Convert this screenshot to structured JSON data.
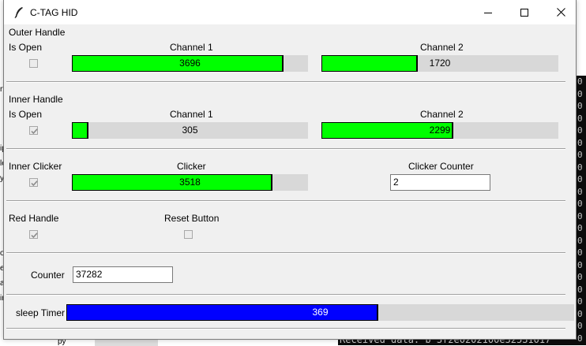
{
  "window": {
    "title": "C-TAG HID"
  },
  "sections": {
    "outer_handle": {
      "title": "Outer Handle",
      "is_open_label": "Is Open",
      "is_open_checked": false,
      "channel1": {
        "label": "Channel 1",
        "value": "3696",
        "fill": 0.895
      },
      "channel2": {
        "label": "Channel 2",
        "value": "1720",
        "fill": 0.405
      }
    },
    "inner_handle": {
      "title": "Inner Handle",
      "is_open_label": "Is Open",
      "is_open_checked": true,
      "channel1": {
        "label": "Channel 1",
        "value": "305",
        "fill": 0.07
      },
      "channel2": {
        "label": "Channel 2",
        "value": "2299",
        "fill": 0.555
      }
    },
    "inner_clicker": {
      "title": "Inner Clicker",
      "checked": true,
      "clicker": {
        "label": "Clicker",
        "value": "3518",
        "fill": 0.85
      },
      "counter_label": "Clicker Counter",
      "counter_value": "2"
    },
    "red_handle": {
      "title": "Red Handle",
      "checked": true,
      "reset_label": "Reset Button",
      "reset_checked": false
    },
    "counter": {
      "label": "Counter",
      "value": "37282"
    },
    "sleep_timer": {
      "label": "sleep Timer",
      "value": "369",
      "fill": 0.615
    }
  },
  "background": {
    "terminal_bottom_text": "Received data: b'3f2e0202100e32531017",
    "terminal_right_chars": [
      "0",
      "0",
      "0",
      "0",
      "0",
      "0",
      "0",
      "0",
      "0",
      "0",
      "0",
      "0",
      "0",
      "0",
      "0",
      "0",
      "0",
      "0",
      "0",
      "0",
      "0",
      "0"
    ],
    "left_fragments": [
      "rt",
      "ip",
      "le",
      "y",
      "ot",
      "er",
      "a",
      "ir"
    ],
    "py_fragment": "py"
  },
  "colors": {
    "bar_fill": "#00ff00",
    "sleep_fill": "#0000ff",
    "trough": "#d8d8d8"
  }
}
